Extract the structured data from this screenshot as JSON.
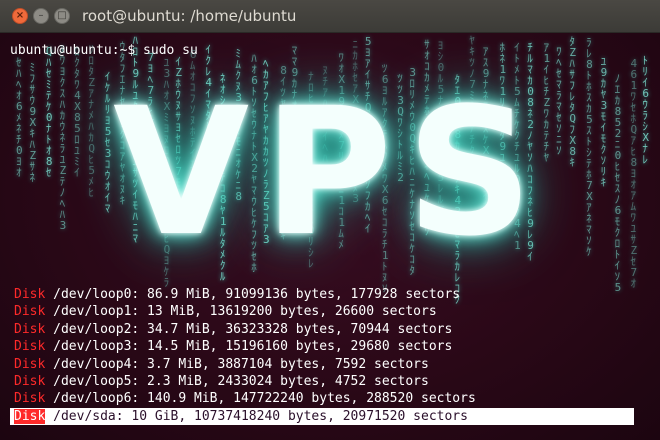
{
  "window": {
    "title": "root@ubuntu: /home/ubuntu",
    "close_icon": "close-icon",
    "minimize_icon": "minimize-icon",
    "maximize_icon": "maximize-icon"
  },
  "terminal": {
    "prompt": "ubuntu@ubuntu:~$ sudo su",
    "banner": "VPS",
    "disk_keyword": "Disk",
    "disk_lines": [
      "/dev/loop0: 86.9 MiB, 91099136 bytes, 177928 sectors",
      "/dev/loop1: 13 MiB, 13619200 bytes, 26600 sectors",
      "/dev/loop2: 34.7 MiB, 36323328 bytes, 70944 sectors",
      "/dev/loop3: 14.5 MiB, 15196160 bytes, 29680 sectors",
      "/dev/loop4: 3.7 MiB, 3887104 bytes, 7592 sectors",
      "/dev/loop5: 2.3 MiB, 2433024 bytes, 4752 sectors",
      "/dev/loop6: 140.9 MiB, 147722240 bytes, 288520 sectors",
      "/dev/sda: 10 GiB, 10737418240 bytes, 20971520 sectors"
    ],
    "highlighted_line_index": 7
  },
  "colors": {
    "titlebar": "#3c3b37",
    "terminal_bg": "#2a0817",
    "matrix_glyph": "#7fe7d6",
    "disk_keyword": "#ff2a2a"
  }
}
